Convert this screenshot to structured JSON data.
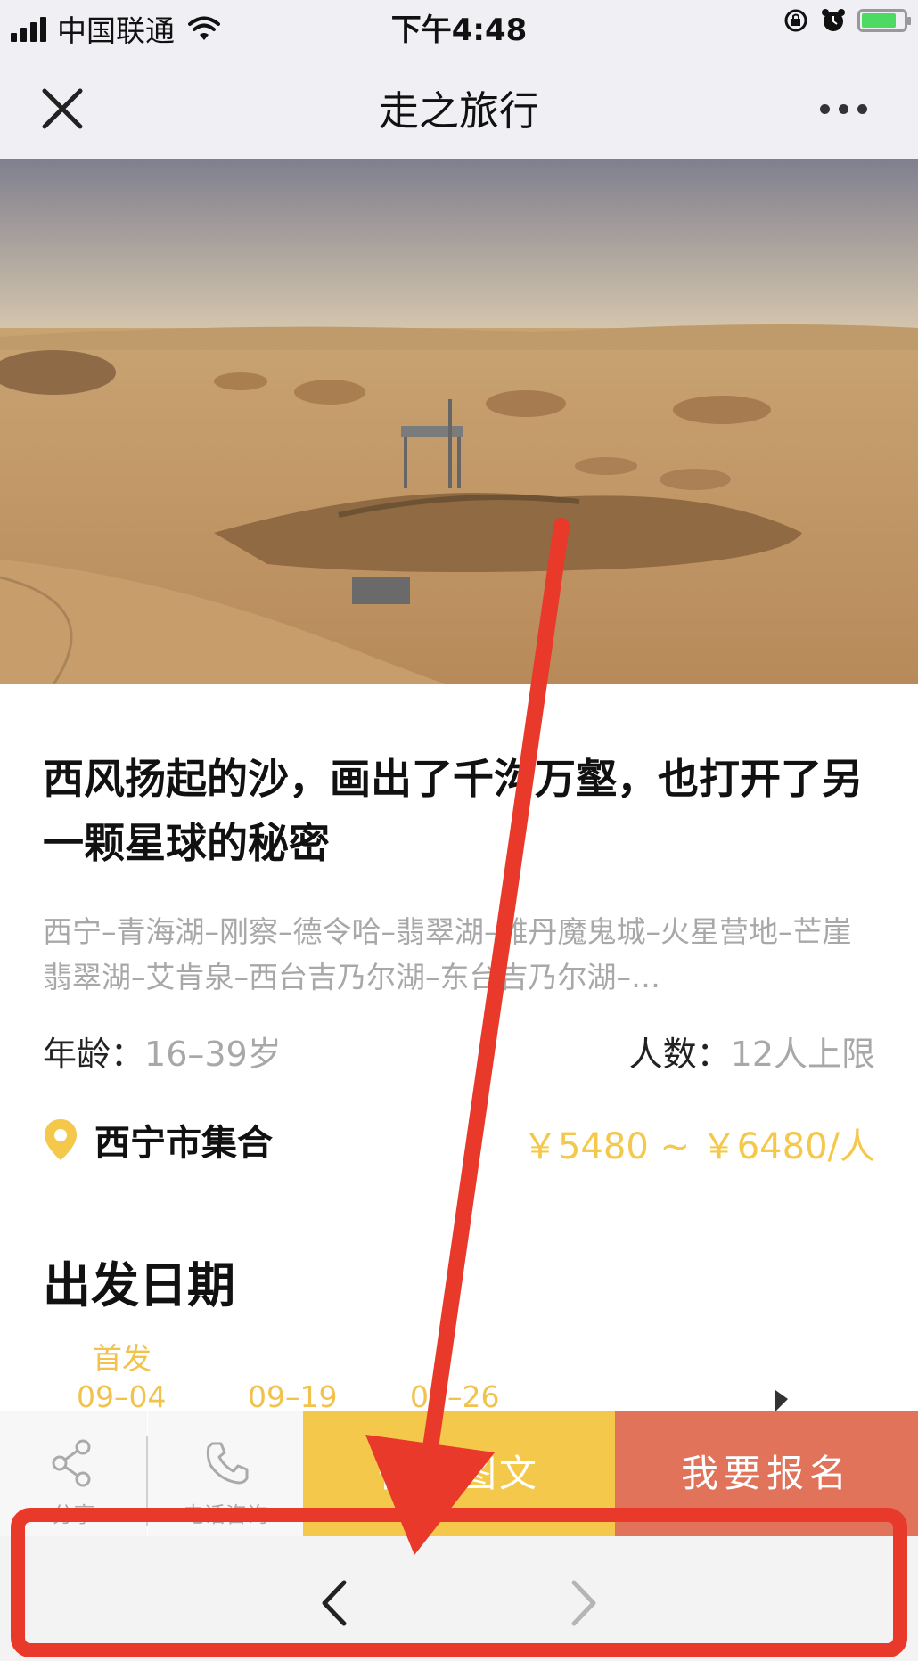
{
  "status_bar": {
    "carrier": "中国联通",
    "time": "下午4:48"
  },
  "nav": {
    "title": "走之旅行"
  },
  "trip": {
    "title": "西风扬起的沙，画出了千沟万壑，也打开了另一颗星球的秘密",
    "route": "西宁–青海湖–刚察–德令哈–翡翠湖–雅丹魔鬼城–火星营地–芒崖翡翠湖–艾肯泉–西台吉乃尔湖–东台吉乃尔湖–…",
    "age_label": "年龄：",
    "age_value": "16–39岁",
    "people_label": "人数：",
    "people_value": "12人上限",
    "meet_point": "西宁市集合",
    "price": "￥5480 ~ ￥6480/人"
  },
  "departure": {
    "section_title": "出发日期",
    "first_label": "首发",
    "dates": [
      "09–04",
      "09–19",
      "09–26"
    ]
  },
  "actions": {
    "share_label": "分享",
    "phone_label": "电话咨询",
    "wechat_label": "微信图文",
    "signup_label": "我要报名"
  },
  "colors": {
    "accent_yellow": "#f4c84a",
    "signup_red": "#e0735a",
    "annotation_red": "#e8392a"
  },
  "icons": [
    "signal-icon",
    "wifi-icon",
    "lock-rotation-icon",
    "alarm-icon",
    "battery-icon",
    "close-icon",
    "more-icon",
    "location-pin-icon",
    "share-icon",
    "phone-icon",
    "back-arrow-icon",
    "forward-arrow-icon"
  ]
}
